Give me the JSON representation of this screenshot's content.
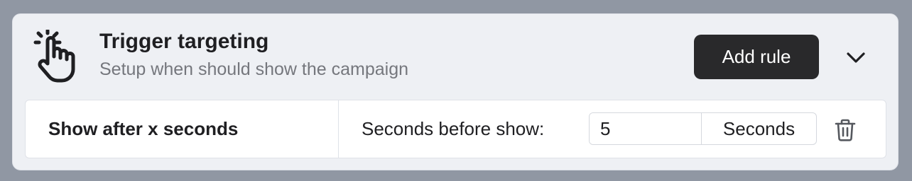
{
  "panel": {
    "title": "Trigger targeting",
    "subtitle": "Setup when should show the campaign",
    "icon": "tap-hand-icon",
    "add_rule_label": "Add rule",
    "collapse_icon": "chevron-down-icon"
  },
  "rule": {
    "name": "Show after x seconds",
    "setting_label": "Seconds before show:",
    "value": "5",
    "unit": "Seconds",
    "delete_icon": "trash-icon"
  }
}
